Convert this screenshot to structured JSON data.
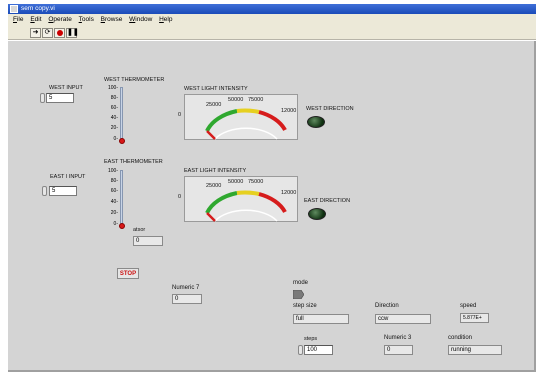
{
  "window": {
    "title": "sem copy.vi"
  },
  "menu": [
    "File",
    "Edit",
    "Operate",
    "Tools",
    "Browse",
    "Window",
    "Help"
  ],
  "toolbar": {
    "run_icon": "run-arrow-icon",
    "run_continuous_icon": "run-continuous-icon",
    "abort_icon": "abort-icon",
    "pause_icon": "pause-icon"
  },
  "west": {
    "input_label": "WEST INPUT",
    "input_value": "5",
    "thermometer_label": "WEST THERMOMETER",
    "thermometer_ticks": [
      "100-",
      "80-",
      "60-",
      "40-",
      "20-",
      "0-"
    ],
    "thermometer_level": 0,
    "light_label": "WEST LIGHT INTENSITY",
    "light_ticks": [
      "0",
      "25000",
      "50000",
      "75000",
      "12000"
    ],
    "direction_label": "WEST DIRECTION"
  },
  "east": {
    "input_label": "EAST I INPUT",
    "input_value": "5",
    "thermometer_label": "EAST THERMOMETER",
    "thermometer_ticks": [
      "100-",
      "80-",
      "60-",
      "40-",
      "20-",
      "0-"
    ],
    "thermometer_level": 0,
    "light_label": "EAST LIGHT INTENSITY",
    "light_ticks": [
      "0",
      "25000",
      "50000",
      "75000",
      "12000"
    ],
    "direction_label": "EAST DIRECTION"
  },
  "atsor": {
    "label": "atsor",
    "value": "0"
  },
  "stop_label": "STOP",
  "numeric7": {
    "label": "Numeric 7",
    "value": "0"
  },
  "mode": {
    "label": "mode"
  },
  "step_size": {
    "label": "step size",
    "value": "full"
  },
  "direction": {
    "label": "Direction",
    "value": "ccw"
  },
  "speed": {
    "label": "speed",
    "value": "5.877E+"
  },
  "steps": {
    "label": "steps",
    "value": "100"
  },
  "numeric3": {
    "label": "Numeric 3",
    "value": "0"
  },
  "condition": {
    "label": "condition",
    "value": "running"
  },
  "colors": {
    "titlebar": "#1a4bb8",
    "panel": "#d4d4d4",
    "led_off": "#0e3010",
    "stop_text": "#cc1010"
  }
}
